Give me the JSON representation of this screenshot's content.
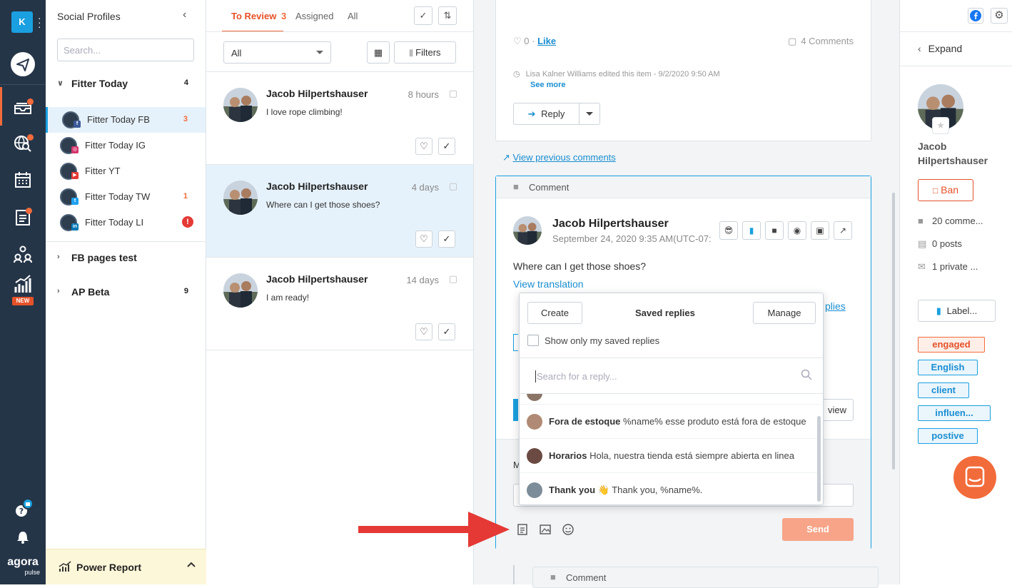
{
  "rail": {
    "account_initial": "K",
    "new_badge": "NEW",
    "logo_text": "agora",
    "logo_sub": "pulse",
    "colors": {
      "bg": "#253548",
      "accent": "#f26b3a",
      "brand": "#1aa0e0"
    }
  },
  "profiles": {
    "title": "Social Profiles",
    "search_placeholder": "Search...",
    "groups": [
      {
        "name": "Fitter Today",
        "count": "4",
        "expanded": true,
        "items": [
          {
            "label": "Fitter Today FB",
            "network": "facebook",
            "count": "3",
            "active": true
          },
          {
            "label": "Fitter Today IG",
            "network": "instagram",
            "count": ""
          },
          {
            "label": "Fitter YT",
            "network": "youtube",
            "count": ""
          },
          {
            "label": "Fitter Today TW",
            "network": "twitter",
            "count": "1"
          },
          {
            "label": "Fitter Today LI",
            "network": "linkedin",
            "count": "",
            "error": "!"
          }
        ]
      },
      {
        "name": "FB pages test",
        "count": ""
      },
      {
        "name": "AP Beta",
        "count": "9"
      }
    ],
    "power_report": "Power Report"
  },
  "list": {
    "tabs": [
      {
        "label": "To Review",
        "count": "3",
        "active": true
      },
      {
        "label": "Assigned"
      },
      {
        "label": "All"
      }
    ],
    "filter_select": "All",
    "filters_button": "Filters",
    "items": [
      {
        "author": "Jacob Hilpertshauser",
        "time": "8 hours",
        "text": "I love rope climbing!"
      },
      {
        "author": "Jacob Hilpertshauser",
        "time": "4 days",
        "text": "Where can I get those shoes?",
        "active": true
      },
      {
        "author": "Jacob Hilpertshauser",
        "time": "14 days",
        "text": "I am ready!"
      }
    ]
  },
  "center": {
    "likes_count": "0",
    "like_label": "Like",
    "comments_count": "4 Comments",
    "edit_note": "Lisa Kalner Williams edited this item - 9/2/2020 9:50 AM",
    "see_more": "See more",
    "reply_button": "Reply",
    "view_previous": "View previous comments",
    "comment_header": "Comment",
    "comment_author": "Jacob Hilpertshauser",
    "comment_date": "September 24, 2020 9:35 AM(UTC-07:",
    "comment_text": "Where can I get those shoes?",
    "view_translation": "View translation",
    "partial_replies": "plies",
    "partial_view": "view",
    "partial_m": "M",
    "send_button": "Send",
    "comment_header_2": "Comment"
  },
  "saved_replies": {
    "create": "Create",
    "title": "Saved replies",
    "manage": "Manage",
    "only_mine": "Show only my saved replies",
    "search_placeholder": "Search for a reply...",
    "rows": [
      {
        "name": "Fora de estoque",
        "text": "%name% esse produto está fora de estoque"
      },
      {
        "name": "Horarios",
        "text": "Hola, nuestra tienda está siempre abierta en linea"
      },
      {
        "name": "Thank you",
        "emoji": "👋",
        "text": "Thank you, %name%."
      }
    ]
  },
  "right": {
    "expand": "Expand",
    "name_line1": "Jacob",
    "name_line2": "Hilpertshauser",
    "ban": "Ban",
    "comments": "20 comme...",
    "posts": "0 posts",
    "private": "1 private ...",
    "label_button": "Label...",
    "tags": [
      {
        "label": "engaged",
        "color": "orange"
      },
      {
        "label": "English",
        "color": "blue"
      },
      {
        "label": "client",
        "color": "blue"
      },
      {
        "label": "influen...",
        "color": "blue"
      },
      {
        "label": "postive",
        "color": "blue"
      }
    ]
  }
}
